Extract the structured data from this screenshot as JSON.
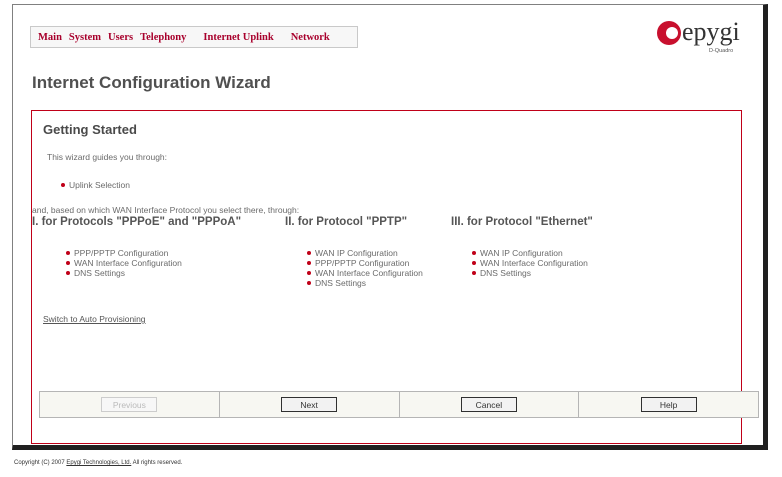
{
  "menu": {
    "items": [
      "Main",
      "System",
      "Users",
      "Telephony",
      "Internet Uplink",
      "Network"
    ]
  },
  "logo": {
    "text": "epygi",
    "subtext": "D-Quadro",
    "color": "#c8102e"
  },
  "page": {
    "title": "Internet Configuration Wizard"
  },
  "panel": {
    "heading": "Getting Started",
    "intro": "This wizard guides you through:",
    "first_step": "Uplink Selection",
    "and_text": "and, based on which WAN Interface Protocol you select there, through:",
    "protocols": [
      {
        "heading": "I. for Protocols \"PPPoE\" and \"PPPoA\"",
        "steps": [
          "PPP/PPTP Configuration",
          "WAN Interface Configuration",
          "DNS Settings"
        ]
      },
      {
        "heading": "II. for Protocol \"PPTP\"",
        "steps": [
          "WAN IP Configuration",
          "PPP/PPTP Configuration",
          "WAN Interface Configuration",
          "DNS Settings"
        ]
      },
      {
        "heading": "III. for Protocol \"Ethernet\"",
        "steps": [
          "WAN IP Configuration",
          "WAN Interface Configuration",
          "DNS Settings"
        ]
      }
    ],
    "auto_link": "Switch to Auto Provisioning"
  },
  "buttons": {
    "previous": "Previous",
    "next": "Next",
    "cancel": "Cancel",
    "help": "Help"
  },
  "footer": {
    "prefix": "Copyright (C) 2007 ",
    "company": "Epygi Technologies, Ltd.",
    "suffix": " All rights reserved."
  },
  "colors": {
    "accent": "#c00018",
    "menu_text": "#a8002c"
  }
}
